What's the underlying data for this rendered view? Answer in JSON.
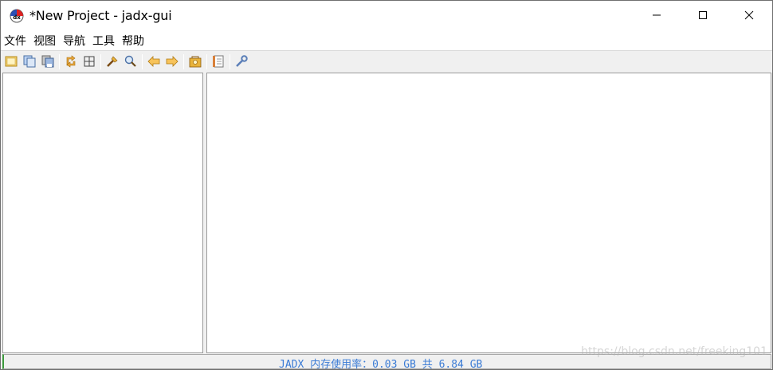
{
  "window": {
    "title": "*New Project - jadx-gui",
    "app_icon": "jadx-logo-icon"
  },
  "controls": {
    "minimize_icon": "minimize-icon",
    "maximize_icon": "maximize-icon",
    "close_icon": "close-icon"
  },
  "menu": {
    "items": [
      {
        "label": "文件"
      },
      {
        "label": "视图"
      },
      {
        "label": "导航"
      },
      {
        "label": "工具"
      },
      {
        "label": "帮助"
      }
    ]
  },
  "toolbar": {
    "icons": [
      "open-file-icon",
      "add-files-icon",
      "save-all-icon",
      "sync-tree-icon",
      "flatten-packages-icon",
      "text-search-icon",
      "class-search-icon",
      "back-icon",
      "forward-icon",
      "deobfuscation-icon",
      "log-viewer-icon",
      "preferences-icon"
    ]
  },
  "status": {
    "memory_text": "JADX 内存使用率：0.03 GB 共 6.84 GB"
  },
  "watermark": {
    "text": "https://blog.csdn.net/freeking101"
  },
  "colors": {
    "status_text": "#3a7bd5",
    "accent_green": "#3c9a3c"
  }
}
